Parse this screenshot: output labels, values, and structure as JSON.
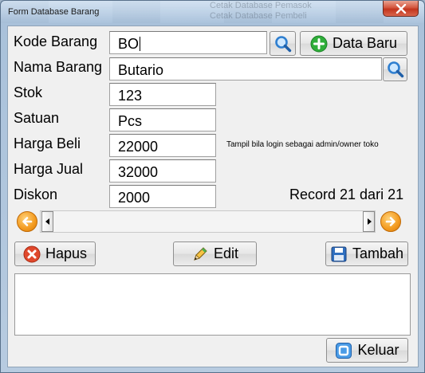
{
  "window": {
    "title": "Form Database Barang",
    "background_fragments": [
      "Cetak Database Pemasok",
      "Cetak Database Pembeli"
    ]
  },
  "form": {
    "kode_barang": {
      "label": "Kode Barang",
      "value": "BO"
    },
    "nama_barang": {
      "label": "Nama Barang",
      "value": "Butario"
    },
    "stok": {
      "label": "Stok",
      "value": "123"
    },
    "satuan": {
      "label": "Satuan",
      "value": "Pcs"
    },
    "harga_beli": {
      "label": "Harga Beli",
      "value": "22000"
    },
    "harga_jual": {
      "label": "Harga Jual",
      "value": "32000"
    },
    "diskon": {
      "label": "Diskon",
      "value": "2000"
    }
  },
  "note": "Tampil bila login sebagai admin/owner toko",
  "record": "Record 21 dari 21",
  "buttons": {
    "data_baru": "Data Baru",
    "hapus": "Hapus",
    "edit": "Edit",
    "tambah": "Tambah",
    "keluar": "Keluar"
  },
  "icons": {
    "search": "search-icon",
    "add": "plus-circle-icon",
    "delete": "x-circle-icon",
    "edit": "pencil-icon",
    "save": "floppy-disk-icon",
    "exit": "exit-icon",
    "prev": "arrow-left-circle-icon",
    "next": "arrow-right-circle-icon"
  },
  "colors": {
    "accent_orange": "#f39a1e",
    "green_add": "#2fae3a",
    "red_delete": "#e0482c",
    "blue_search": "#2f7fd0"
  }
}
